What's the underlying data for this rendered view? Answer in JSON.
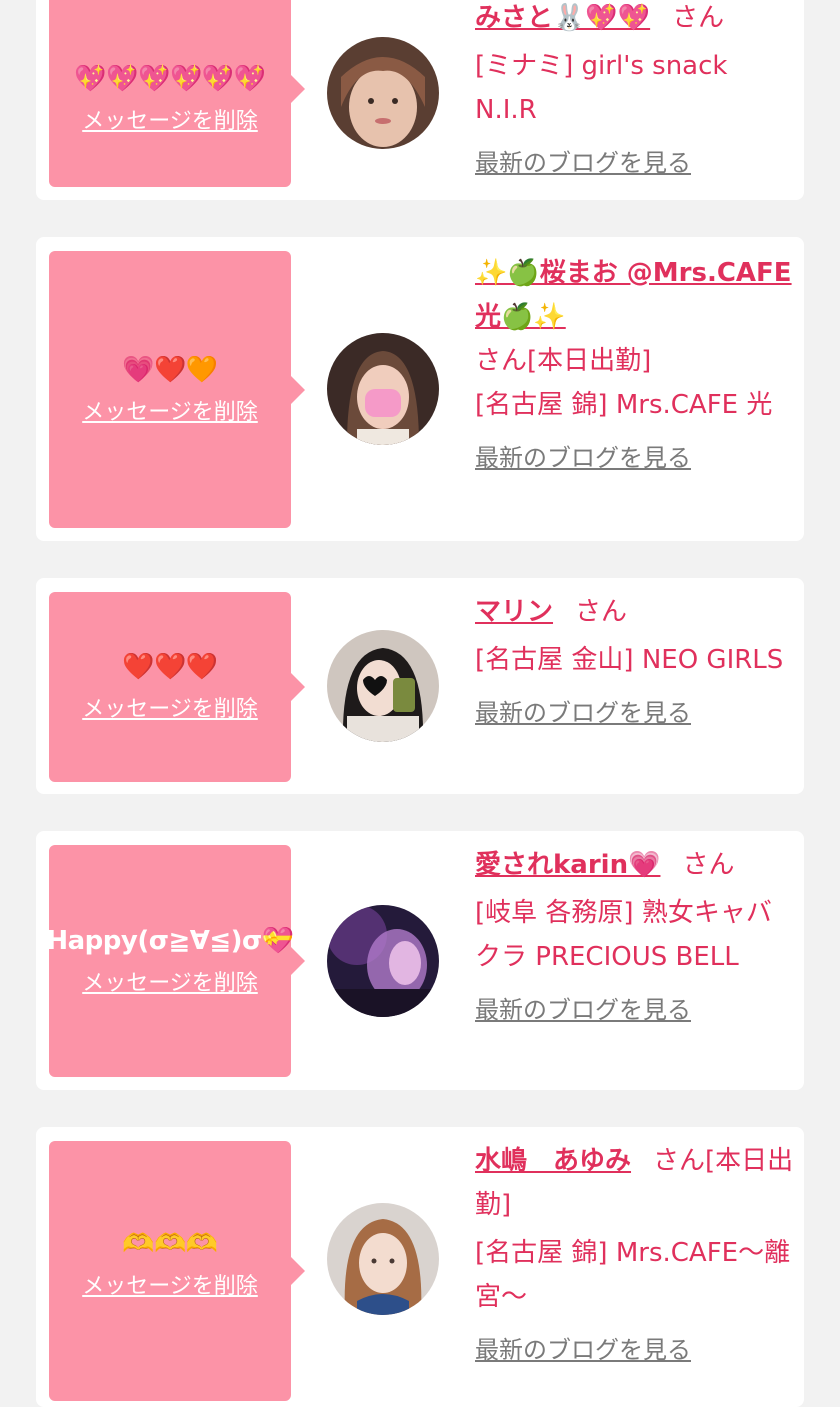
{
  "common": {
    "delete_label": "メッセージを削除",
    "blog_label": "最新のブログを見る",
    "san": "さん"
  },
  "cards": [
    {
      "message": "💖💖💖💖💖💖",
      "name": "みさと🐰💖💖",
      "suffix": "",
      "shop": "[ミナミ] girl's snack N.I.R",
      "avatar_icon": "avatar-photo"
    },
    {
      "message": "💗❤️🧡",
      "name": "✨🍏桜まお @Mrs.CAFE光🍏✨",
      "suffix": "[本日出勤]",
      "shop": "[名古屋 錦] Mrs.CAFE 光",
      "avatar_icon": "avatar-photo"
    },
    {
      "message": "❤️❤️❤️",
      "name": "マリン",
      "suffix": "",
      "shop": "[名古屋 金山] NEO GIRLS",
      "avatar_icon": "avatar-photo"
    },
    {
      "message": "Happy(σ≧∀≦)σ💝",
      "name": "愛されkarin💗",
      "suffix": "",
      "shop": "[岐阜 各務原]  熟女キャバクラ PRECIOUS BELL",
      "avatar_icon": "avatar-photo"
    },
    {
      "message": "🫶🫶🫶",
      "name": "水嶋　あゆみ",
      "suffix": "[本日出勤]",
      "shop": "[名古屋 錦] Mrs.CAFE～離宮～",
      "avatar_icon": "avatar-photo"
    }
  ]
}
